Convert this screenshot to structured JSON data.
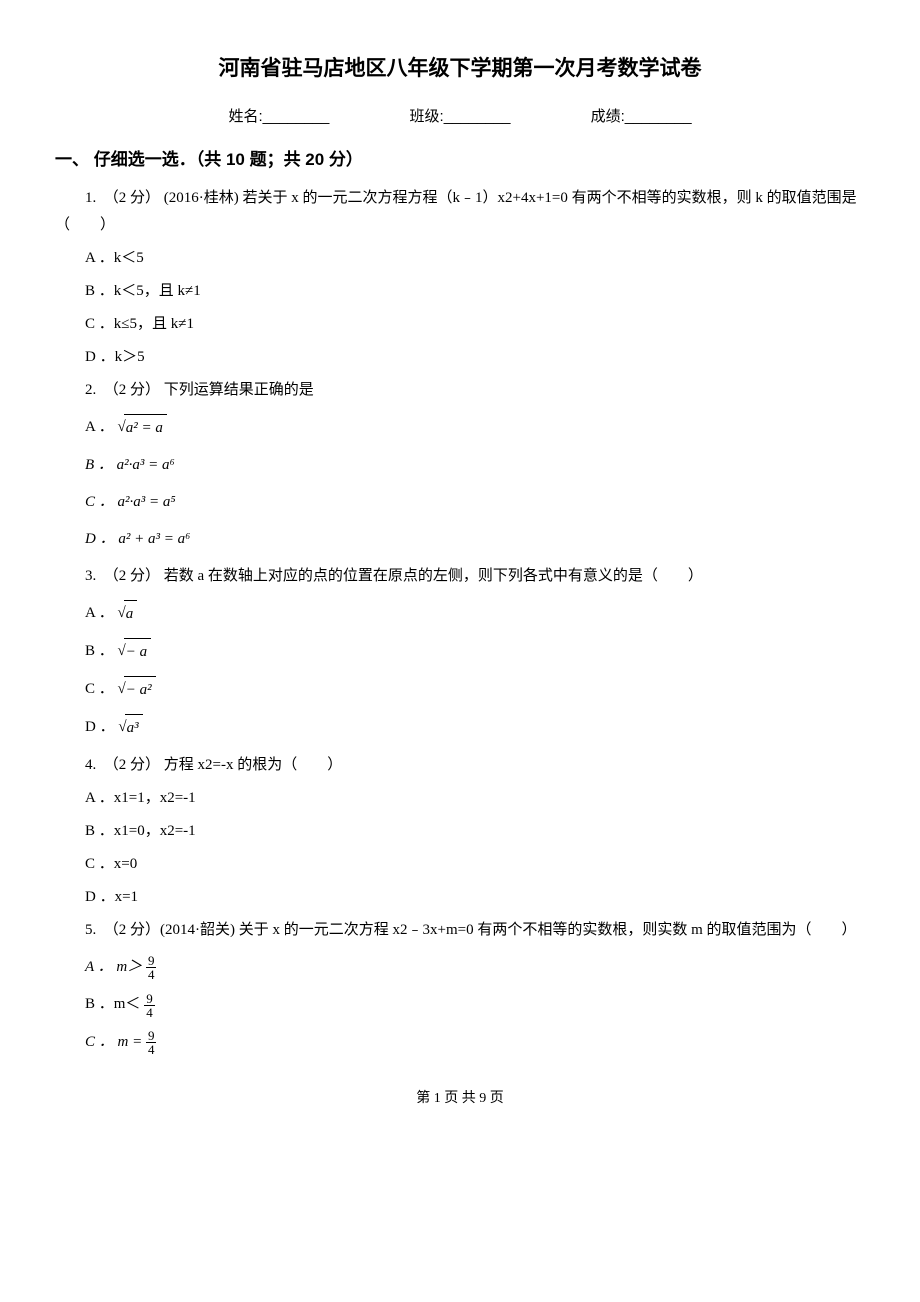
{
  "title": "河南省驻马店地区八年级下学期第一次月考数学试卷",
  "info": {
    "name": "姓名:________",
    "class": "班级:________",
    "score": "成绩:________"
  },
  "section1": {
    "header": "一、 仔细选一选．（共 10 题；共 20 分）"
  },
  "q1": {
    "text": "1.　（2 分）  (2016·桂林) 若关于 x 的一元二次方程方程（k﹣1）x2+4x+1=0 有两个不相等的实数根，则 k 的取值范围是（　　）",
    "A": "A ．k＜5",
    "B": "B ．k＜5，且 k≠1",
    "C": "C ．k≤5，且 k≠1",
    "D": "D ．k＞5"
  },
  "q2": {
    "text": "2.　（2 分）  下列运算结果正确的是",
    "A_pre": "A ．",
    "A_rad": "a² = a",
    "B": "B ． a²·a³ = a⁶",
    "C": "C ． a²·a³ = a⁵",
    "D": "D ． a² + a³ = a⁶"
  },
  "q3": {
    "text": "3.　（2 分）  若数 a 在数轴上对应的点的位置在原点的左侧，则下列各式中有意义的是（　　）",
    "A_pre": "A ．",
    "A_rad": "a",
    "B_pre": "B ．",
    "B_rad": "− a",
    "C_pre": "C ．",
    "C_rad": "− a²",
    "D_pre": "D ．",
    "D_rad": "a³"
  },
  "q4": {
    "text": "4.　（2 分）  方程 x2=-x 的根为（　　）",
    "A": "A ．x1=1，x2=-1",
    "B": "B ．x1=0，x2=-1",
    "C": "C ．x=0",
    "D": "D ．x=1"
  },
  "q5": {
    "text": "5.　（2 分）(2014·韶关) 关于 x 的一元二次方程 x2﹣3x+m=0 有两个不相等的实数根，则实数 m 的取值范围为（　　）",
    "A_pre": "A ． m＞",
    "A_num": "9",
    "A_den": "4",
    "B_pre": "B ．m＜ ",
    "B_num": "9",
    "B_den": "4",
    "C_pre": "C ． m = ",
    "C_num": "9",
    "C_den": "4"
  },
  "footer": "第 1 页 共 9 页"
}
